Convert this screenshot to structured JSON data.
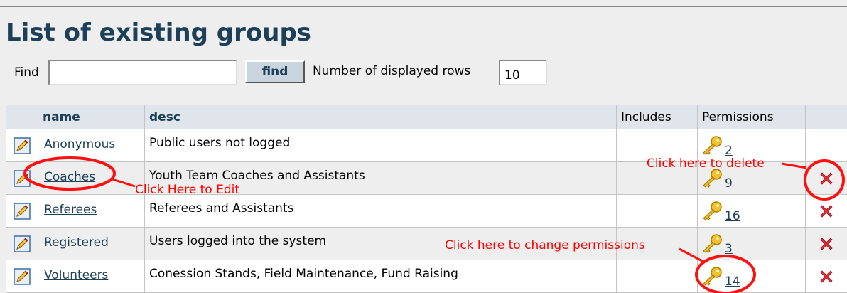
{
  "page": {
    "title": "List of existing groups"
  },
  "search": {
    "find_label": "Find",
    "find_value": "",
    "find_button": "find",
    "rows_label": "Number of displayed rows",
    "rows_value": "10"
  },
  "table": {
    "headers": {
      "name": "name",
      "desc": "desc",
      "includes": "Includes",
      "permissions": "Permissions"
    },
    "rows": [
      {
        "name": "Anonymous",
        "desc": "Public users not logged",
        "includes": "",
        "permissions": "2",
        "deletable": false
      },
      {
        "name": "Coaches",
        "desc": "Youth Team Coaches and Assistants",
        "includes": "",
        "permissions": "9",
        "deletable": true
      },
      {
        "name": "Referees",
        "desc": "Referees and Assistants",
        "includes": "",
        "permissions": "16",
        "deletable": true
      },
      {
        "name": "Registered",
        "desc": "Users logged into the system",
        "includes": "",
        "permissions": "3",
        "deletable": true
      },
      {
        "name": "Volunteers",
        "desc": "Conession Stands, Field Maintenance, Fund Raising",
        "includes": "",
        "permissions": "14",
        "deletable": true
      }
    ]
  },
  "annotations": {
    "edit": "Click Here to Edit",
    "delete": "Click here to delete",
    "permissions": "Click here to change permissions"
  },
  "icons": {
    "edit": "pencil-icon",
    "permissions": "key-icon",
    "delete": "delete-x-icon"
  },
  "colors": {
    "title": "#1d3f57",
    "link": "#1d3f57",
    "annotation": "#ff0000",
    "delete": "#e02020",
    "header_bg": "#dfe5ea"
  }
}
